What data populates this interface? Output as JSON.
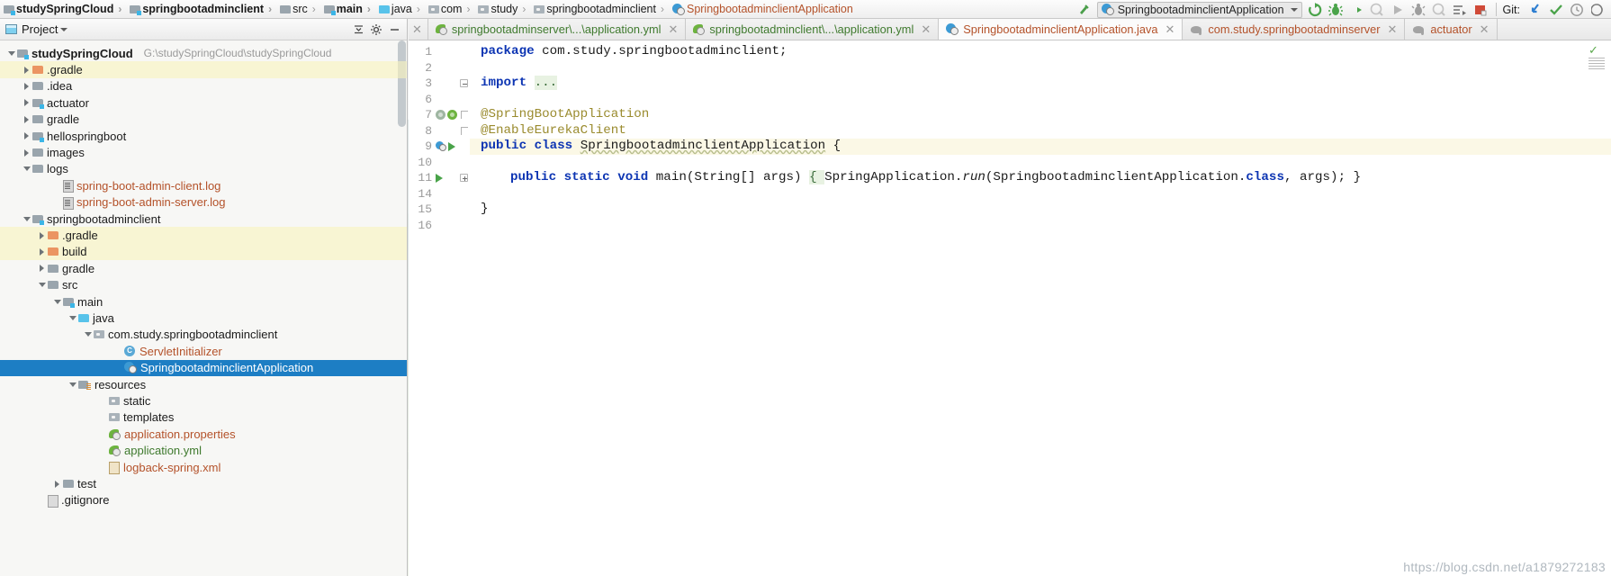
{
  "breadcrumb": {
    "items": [
      {
        "label": "studySpringCloud",
        "icon": "module-icon",
        "bold": true,
        "color": "dark"
      },
      {
        "label": "springbootadminclient",
        "icon": "module-icon",
        "bold": true,
        "color": "dark"
      },
      {
        "label": "src",
        "icon": "folder-icon",
        "bold": false,
        "color": "dark"
      },
      {
        "label": "main",
        "icon": "module-icon",
        "bold": true,
        "color": "dark"
      },
      {
        "label": "java",
        "icon": "source-folder-icon",
        "bold": false,
        "color": "dark"
      },
      {
        "label": "com",
        "icon": "package-icon",
        "bold": false,
        "color": "dark"
      },
      {
        "label": "study",
        "icon": "package-icon",
        "bold": false,
        "color": "dark"
      },
      {
        "label": "springbootadminclient",
        "icon": "package-icon",
        "bold": false,
        "color": "dark"
      },
      {
        "label": "SpringbootadminclientApplication",
        "icon": "spring-class-icon",
        "bold": false,
        "color": "orange"
      }
    ]
  },
  "toolbar": {
    "build_icon": "hammer-icon",
    "run_config": {
      "label": "SpringbootadminclientApplication",
      "icon": "spring-class-icon",
      "dropdown_icon": "chevron-down-icon"
    },
    "buttons": [
      {
        "name": "rerun-icon",
        "glyph": "↻",
        "color": "#4aa34a",
        "enabled": true
      },
      {
        "name": "debug-icon",
        "glyph": "⚙",
        "color": "#4aa34a",
        "enabled": true
      },
      {
        "name": "run-with-coverage-icon",
        "glyph": "▶",
        "color": "#4a4a4a",
        "enabled": true
      },
      {
        "name": "profile-icon",
        "glyph": "◔",
        "color": "#b5b5b5",
        "enabled": false
      },
      {
        "name": "play-icon",
        "glyph": "▶",
        "color": "#b0b0b0",
        "enabled": false
      },
      {
        "name": "stop-icon",
        "glyph": "■",
        "color": "#9e9e9e",
        "enabled": false
      },
      {
        "name": "attach-debugger-icon",
        "glyph": "◔",
        "color": "#b5b5b5",
        "enabled": false
      },
      {
        "name": "run-dashboard-icon",
        "glyph": "≡",
        "color": "#6e6e6e",
        "enabled": true
      },
      {
        "name": "stop-red-icon",
        "glyph": "■",
        "color": "#d04a38",
        "enabled": true
      }
    ],
    "git": {
      "label": "Git:",
      "update_icon": "update-project-icon",
      "commit_icon": "commit-checkmark-icon",
      "history_icon": "history-clock-icon",
      "more_icon": "more-icon"
    }
  },
  "project_panel": {
    "title": "Project",
    "title_dropdown_icon": "chevron-down-icon",
    "collapse_icon": "collapse-all-icon",
    "settings_icon": "gear-icon",
    "hide_icon": "minimize-icon",
    "tree": [
      {
        "label": "studySpringCloud",
        "path": "G:\\studySpringCloud\\studySpringCloud",
        "depth": 0,
        "icon": "module-icon",
        "state": "expanded",
        "color": "dark",
        "bold": true
      },
      {
        "label": ".gradle",
        "depth": 1,
        "icon": "folder-orange-icon",
        "state": "collapsed",
        "color": "dark",
        "excluded": true
      },
      {
        "label": ".idea",
        "depth": 1,
        "icon": "folder-icon",
        "state": "collapsed",
        "color": "dark"
      },
      {
        "label": "actuator",
        "depth": 1,
        "icon": "module-icon",
        "state": "collapsed",
        "color": "dark"
      },
      {
        "label": "gradle",
        "depth": 1,
        "icon": "folder-icon",
        "state": "collapsed",
        "color": "dark"
      },
      {
        "label": "hellospringboot",
        "depth": 1,
        "icon": "module-icon",
        "state": "collapsed",
        "color": "dark"
      },
      {
        "label": "images",
        "depth": 1,
        "icon": "folder-icon",
        "state": "collapsed",
        "color": "dark"
      },
      {
        "label": "logs",
        "depth": 1,
        "icon": "folder-icon",
        "state": "expanded",
        "color": "dark"
      },
      {
        "label": "spring-boot-admin-client.log",
        "depth": 3,
        "icon": "log-file-icon",
        "state": "leaf",
        "color": "orange"
      },
      {
        "label": "spring-boot-admin-server.log",
        "depth": 3,
        "icon": "log-file-icon",
        "state": "leaf",
        "color": "orange"
      },
      {
        "label": "springbootadminclient",
        "depth": 1,
        "icon": "module-icon",
        "state": "expanded",
        "color": "dark"
      },
      {
        "label": ".gradle",
        "depth": 2,
        "icon": "folder-orange-icon",
        "state": "collapsed",
        "color": "dark",
        "excluded": true
      },
      {
        "label": "build",
        "depth": 2,
        "icon": "folder-orange-icon",
        "state": "collapsed",
        "color": "dark",
        "excluded": true
      },
      {
        "label": "gradle",
        "depth": 2,
        "icon": "folder-icon",
        "state": "collapsed",
        "color": "dark"
      },
      {
        "label": "src",
        "depth": 2,
        "icon": "folder-icon",
        "state": "expanded",
        "color": "dark"
      },
      {
        "label": "main",
        "depth": 3,
        "icon": "module-icon",
        "state": "expanded",
        "color": "dark"
      },
      {
        "label": "java",
        "depth": 4,
        "icon": "source-folder-icon",
        "state": "expanded",
        "color": "dark"
      },
      {
        "label": "com.study.springbootadminclient",
        "depth": 5,
        "icon": "package-icon",
        "state": "expanded",
        "color": "dark"
      },
      {
        "label": "ServletInitializer",
        "depth": 7,
        "icon": "class-icon",
        "state": "leaf",
        "color": "orange"
      },
      {
        "label": "SpringbootadminclientApplication",
        "depth": 7,
        "icon": "spring-class-icon",
        "state": "leaf",
        "color": "orange",
        "selected": true
      },
      {
        "label": "resources",
        "depth": 4,
        "icon": "resources-folder-icon",
        "state": "expanded",
        "color": "dark"
      },
      {
        "label": "static",
        "depth": 6,
        "icon": "package-icon",
        "state": "leaf",
        "color": "dark"
      },
      {
        "label": "templates",
        "depth": 6,
        "icon": "package-icon",
        "state": "leaf",
        "color": "dark"
      },
      {
        "label": "application.properties",
        "depth": 6,
        "icon": "spring-config-icon",
        "state": "leaf",
        "color": "orange"
      },
      {
        "label": "application.yml",
        "depth": 6,
        "icon": "spring-config-icon",
        "state": "leaf",
        "color": "green"
      },
      {
        "label": "logback-spring.xml",
        "depth": 6,
        "icon": "xml-file-icon",
        "state": "leaf",
        "color": "orange"
      },
      {
        "label": "test",
        "depth": 3,
        "icon": "folder-icon",
        "state": "collapsed",
        "color": "dark"
      },
      {
        "label": ".gitignore",
        "depth": 2,
        "icon": "gitignore-file-icon",
        "state": "leaf",
        "color": "dark"
      }
    ]
  },
  "editor_tabs": [
    {
      "label": "springbootadminserver\\...\\application.yml",
      "icon": "spring-config-icon",
      "active": false,
      "color": "green",
      "closable": true
    },
    {
      "label": "springbootadminclient\\...\\application.yml",
      "icon": "spring-config-icon",
      "active": false,
      "color": "green",
      "closable": true
    },
    {
      "label": "SpringbootadminclientApplication.java",
      "icon": "spring-class-icon",
      "active": true,
      "color": "orange",
      "closable": true
    },
    {
      "label": "com.study.springbootadminserver",
      "icon": "gradle-icon",
      "active": false,
      "color": "orange",
      "closable": true
    },
    {
      "label": "actuator",
      "icon": "gradle-icon",
      "active": false,
      "color": "orange",
      "closable": true
    }
  ],
  "code": {
    "lines": [
      {
        "num": "1",
        "indent": 0,
        "tokens": [
          {
            "t": "package",
            "c": "kw"
          },
          {
            "t": " com.study.springbootadminclient;",
            "c": "plain"
          }
        ]
      },
      {
        "num": "2",
        "indent": 0,
        "tokens": []
      },
      {
        "num": "3",
        "indent": 0,
        "fold": "minus",
        "tokens": [
          {
            "t": "import",
            "c": "kw"
          },
          {
            "t": " ",
            "c": "plain"
          },
          {
            "t": "...",
            "c": "fold"
          }
        ]
      },
      {
        "num": "6",
        "indent": 0,
        "tokens": []
      },
      {
        "num": "7",
        "indent": 0,
        "fold": "bracket",
        "gutter_icons": [
          "bean-gray-icon",
          "bean-green-icon"
        ],
        "tokens": [
          {
            "t": "@SpringBootApplication",
            "c": "anno"
          }
        ]
      },
      {
        "num": "8",
        "indent": 0,
        "fold": "bracket2",
        "tokens": [
          {
            "t": "@EnableEurekaClient",
            "c": "anno"
          }
        ]
      },
      {
        "num": "9",
        "indent": 0,
        "current": true,
        "gutter_icons": [
          "spring-bean-icon",
          "run-icon"
        ],
        "tokens": [
          {
            "t": "public",
            "c": "kw"
          },
          {
            "t": " ",
            "c": "plain"
          },
          {
            "t": "class",
            "c": "kw"
          },
          {
            "t": " ",
            "c": "plain"
          },
          {
            "t": "SpringbootadminclientApplication",
            "c": "wavy"
          },
          {
            "t": " {",
            "c": "plain"
          }
        ]
      },
      {
        "num": "10",
        "indent": 0,
        "tokens": []
      },
      {
        "num": "11",
        "indent": 1,
        "fold": "plus",
        "gutter_icons": [
          "run-icon"
        ],
        "tokens": [
          {
            "t": "public",
            "c": "kw"
          },
          {
            "t": " ",
            "c": "plain"
          },
          {
            "t": "static",
            "c": "kw"
          },
          {
            "t": " ",
            "c": "plain"
          },
          {
            "t": "void",
            "c": "kw"
          },
          {
            "t": " main(String[] args) ",
            "c": "plain"
          },
          {
            "t": "{ ",
            "c": "fold"
          },
          {
            "t": "SpringApplication.",
            "c": "plain"
          },
          {
            "t": "run",
            "c": "ital"
          },
          {
            "t": "(SpringbootadminclientApplication.",
            "c": "plain"
          },
          {
            "t": "class",
            "c": "kw"
          },
          {
            "t": ", args); }",
            "c": "plain"
          }
        ]
      },
      {
        "num": "14",
        "indent": 0,
        "tokens": []
      },
      {
        "num": "15",
        "indent": 0,
        "tokens": [
          {
            "t": "}",
            "c": "plain"
          }
        ]
      },
      {
        "num": "16",
        "indent": 0,
        "tokens": []
      }
    ]
  },
  "watermark": "https://blog.csdn.net/a1879272183",
  "colors": {
    "selection_blue": "#1d7ec4",
    "excluded_yellow": "#f8f3be",
    "orange_text": "#b4522a",
    "green_text": "#3f7a2e",
    "keyword_blue": "#0d35b3",
    "annotation_olive": "#9a8b2e",
    "spring_green": "#6db33f",
    "current_line": "#fbf8e6"
  }
}
